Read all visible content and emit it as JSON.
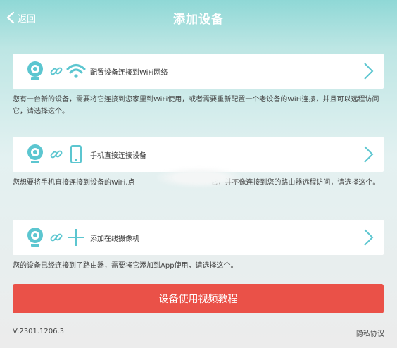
{
  "header": {
    "back_label": "返回",
    "title": "添加设备"
  },
  "colors": {
    "accent": "#5cc6d0",
    "button": "#ea5148"
  },
  "options": [
    {
      "label": "配置设备连接到WiFi网络",
      "icons": [
        "camera-icon",
        "link-icon",
        "wifi-icon",
        "chevron-right-icon"
      ],
      "description": "您有一台新的设备，需要将它连接到您家里到WiFi使用，或者需要重新配置一个老设备的WiFi连接，并且可以远程访问它，请选择这个。"
    },
    {
      "label": "手机直接连接设备",
      "icons": [
        "camera-icon",
        "link-icon",
        "phone-icon",
        "chevron-right-icon"
      ],
      "description_part1": "您想要将手机直接连接到设备的WiFi,点",
      "description_part2": "它，并不像连接到您的路由器远程访问，请选择这个。"
    },
    {
      "label": "添加在线摄像机",
      "icons": [
        "camera-icon",
        "link-icon",
        "plus-icon",
        "chevron-right-icon"
      ],
      "description": "您的设备已经连接到了路由器，需要将它添加到App使用，请选择这个。"
    }
  ],
  "tutorial_button": "设备使用视频教程",
  "footer": {
    "version": "V:2301.1206.3",
    "privacy": "隐私协议"
  }
}
